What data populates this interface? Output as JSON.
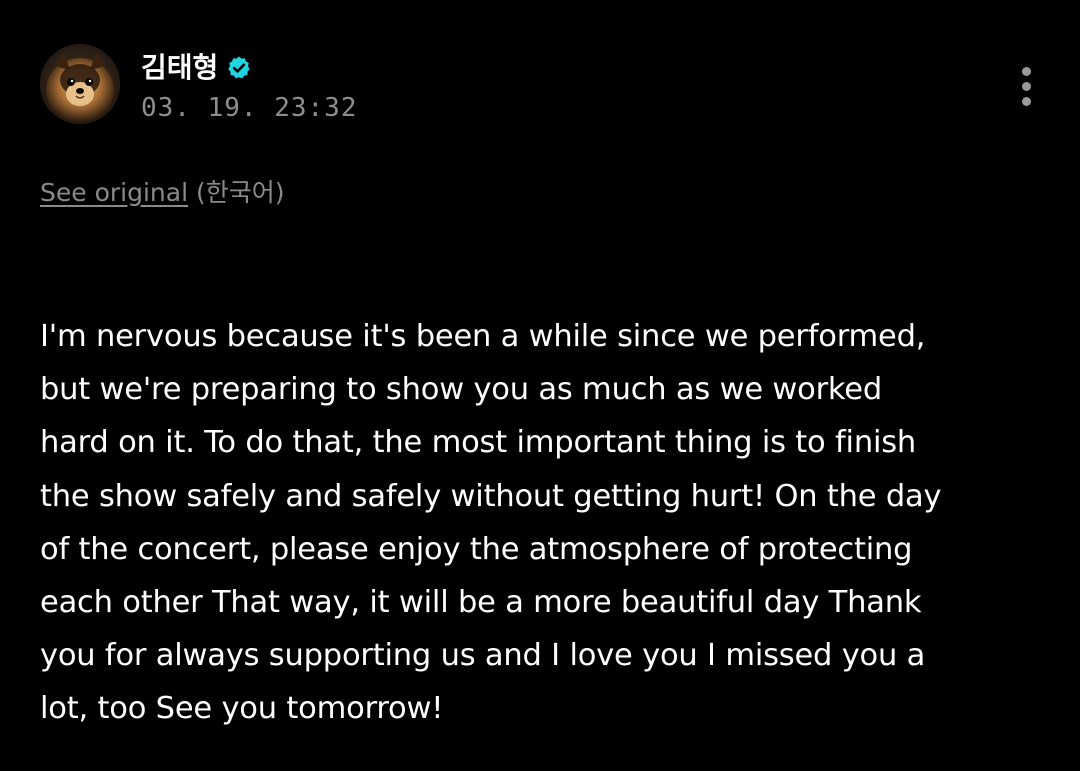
{
  "post": {
    "author": {
      "name": "김태형",
      "verified": true,
      "avatar_icon": "pomeranian-dog-avatar"
    },
    "timestamp": "03. 19. 23:32",
    "menu_icon": "more-vertical-icon",
    "translation": {
      "see_original_label": "See original",
      "language_label": " (한국어)"
    },
    "body": "I'm nervous because it's been a while since we performed,\nbut we're preparing to show you as much as we worked\nhard on it. To do that, the most important thing is to finish\nthe show safely and safely without getting hurt! On the day\nof the concert, please enjoy the atmosphere of protecting\neach other That way, it will be a more beautiful day Thank\nyou for always supporting us and I love you I missed you a\nlot, too See you tomorrow!"
  },
  "colors": {
    "background": "#000000",
    "text_primary": "#ffffff",
    "text_secondary": "#8e8e8e",
    "verified_badge": "#1fd3e0"
  }
}
